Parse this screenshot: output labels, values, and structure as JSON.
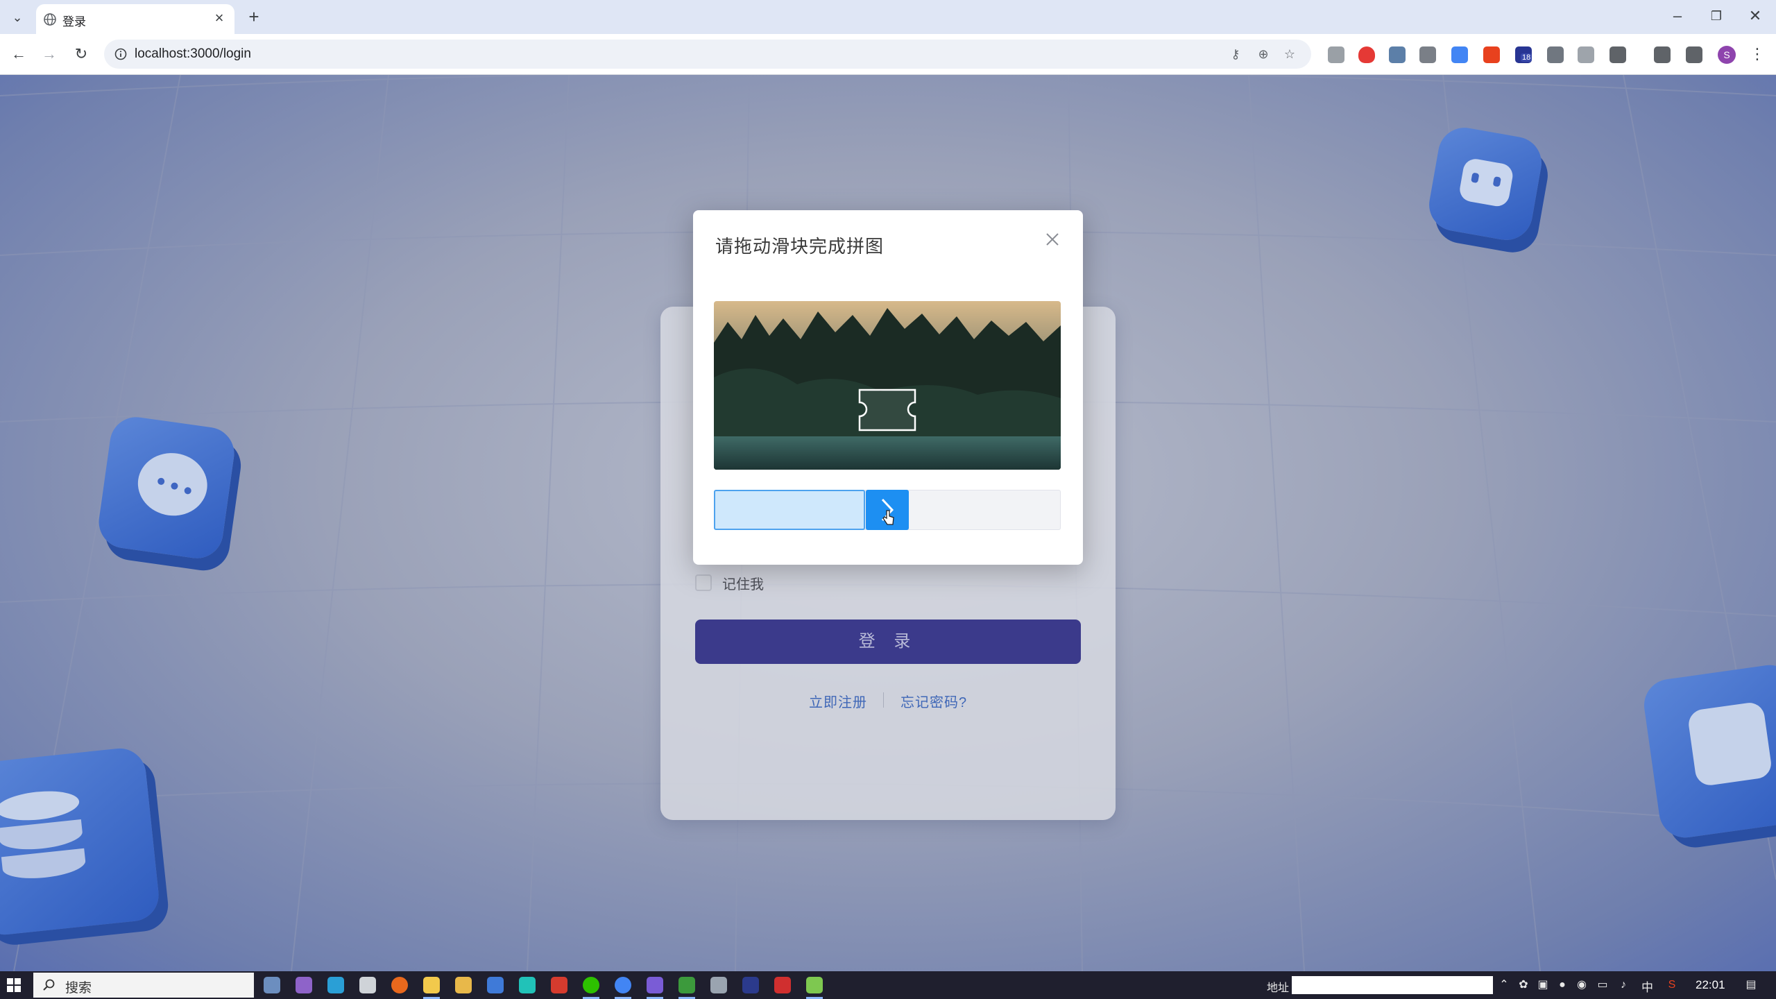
{
  "browser": {
    "tab_title": "登录",
    "url": "localhost:3000/login",
    "profile_initial": "S",
    "extension_badge": "18"
  },
  "login": {
    "remember_label": "记住我",
    "submit_label": "登 录",
    "register_link": "立即注册",
    "forgot_link": "忘记密码?"
  },
  "captcha": {
    "title": "请拖动滑块完成拼图",
    "slider_progress": 0.43,
    "slider_icon": "chevron-right-icon"
  },
  "taskbar": {
    "search_text": "搜索",
    "address_label": "地址",
    "ime_label": "中",
    "clock": "22:01"
  },
  "colors": {
    "primary_button": "#3b3a8b",
    "slider_handle": "#1d8ff2",
    "link": "#3f67b7"
  }
}
